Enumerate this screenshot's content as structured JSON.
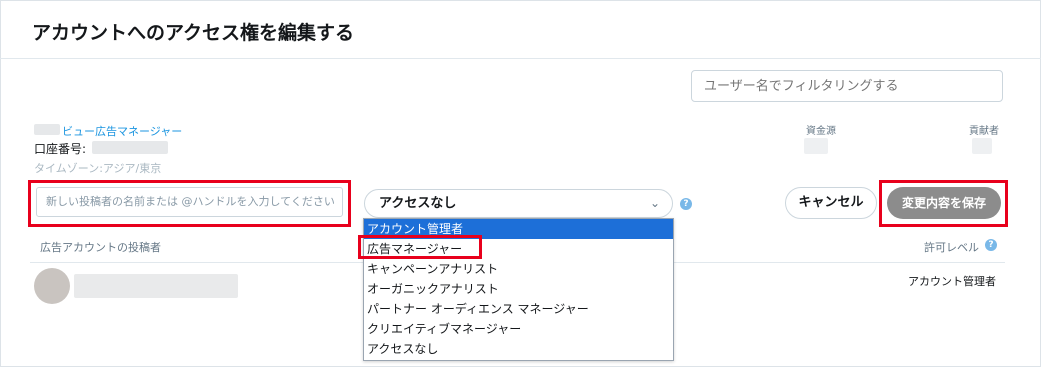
{
  "dialog": {
    "title": "アカウントへのアクセス権を編集する"
  },
  "filter": {
    "placeholder": "ユーザー名でフィルタリングする"
  },
  "account": {
    "name_label": "ビュー広告マネージャー",
    "number_label": "口座番号:",
    "timezone": "タイムゾーン:アジア/東京"
  },
  "columns": {
    "funding_source": "資金源",
    "contributor": "貢献者",
    "account_poster": "広告アカウントの投稿者",
    "permission_level": "許可レベル"
  },
  "new_poster": {
    "placeholder": "新しい投稿者の名前または @ハンドルを入力してください"
  },
  "access_select": {
    "value": "アクセスなし",
    "options": [
      "アカウント管理者",
      "広告マネージャー",
      "キャンペーンアナリスト",
      "オーガニックアナリスト",
      "パートナー オーディエンス マネージャー",
      "クリエイティブマネージャー",
      "アクセスなし"
    ],
    "highlighted_index": 0
  },
  "buttons": {
    "cancel": "キャンセル",
    "save": "変更内容を保存"
  },
  "existing_row": {
    "permission": "アカウント管理者"
  },
  "icons": {
    "chevron": "chevron-down-icon",
    "help": "help-circle-icon"
  },
  "colors": {
    "link": "#1b95e0",
    "highlight_box": "#e8001c",
    "save_button": "#8c8c8c",
    "selected_option": "#1d6fd8"
  }
}
